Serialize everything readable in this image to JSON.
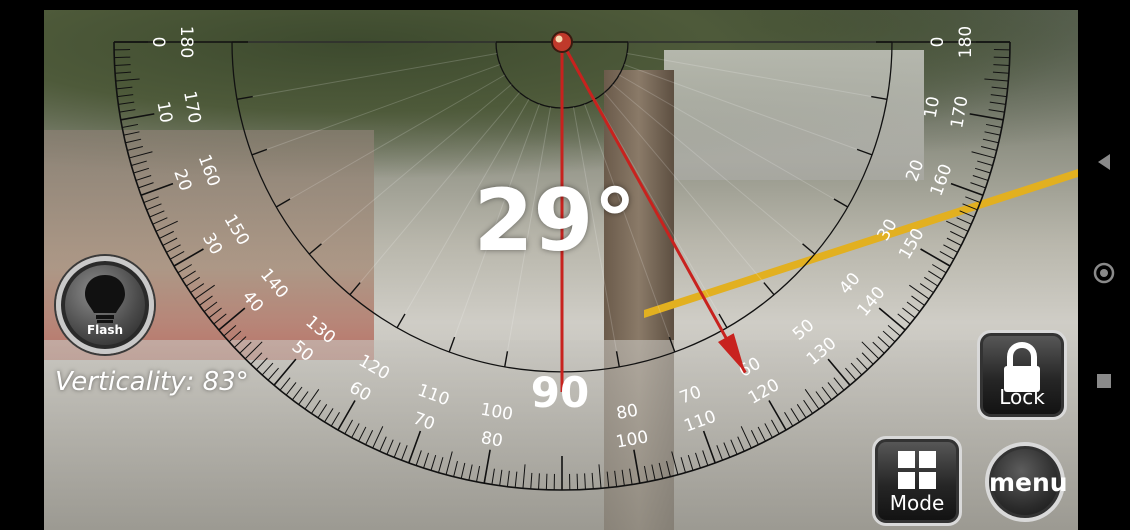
{
  "angle_display": "29°",
  "center_scale_label": "90",
  "verticality_text": "Verticality: 83°",
  "buttons": {
    "flash_label": "Flash",
    "lock_label": "Lock",
    "mode_label": "Mode",
    "menu_label": "menu"
  },
  "protractor": {
    "outer_scale_left": [
      "0",
      "10",
      "20",
      "30",
      "40",
      "50",
      "60",
      "70",
      "80"
    ],
    "inner_scale_left": [
      "180",
      "170",
      "160",
      "150",
      "140",
      "130",
      "120",
      "110",
      "100"
    ],
    "outer_scale_right": [
      "100",
      "110",
      "120",
      "130",
      "140",
      "150",
      "160",
      "170",
      "180"
    ],
    "inner_scale_right": [
      "80",
      "70",
      "60",
      "50",
      "40",
      "30",
      "20",
      "10",
      "0"
    ],
    "needle_angle_deg": 29
  },
  "colors": {
    "needle": "#c8221e",
    "scale": "#111111",
    "text": "#ffffff"
  },
  "icons": {
    "flash": "lightbulb-icon",
    "lock": "padlock-icon",
    "mode": "grid-icon",
    "nav_back": "triangle-back-icon",
    "nav_home": "circle-home-icon",
    "nav_recent": "square-recent-icon"
  }
}
